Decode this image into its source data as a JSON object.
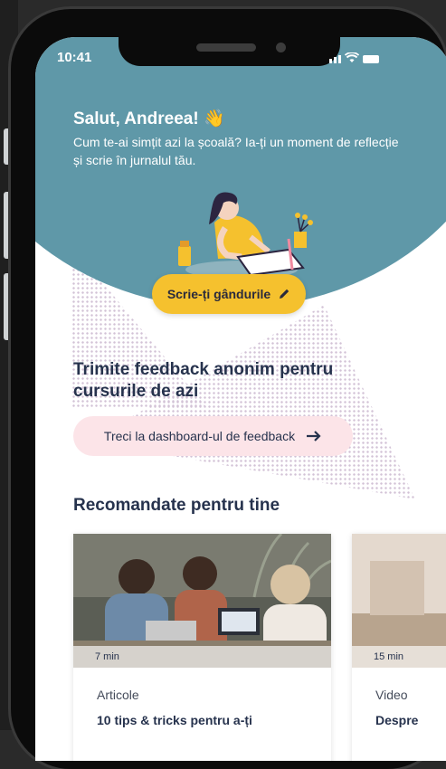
{
  "status_bar": {
    "time": "10:41"
  },
  "header": {
    "greeting": "Salut, Andreea! 👋",
    "subtitle": "Cum te-ai simțit azi la școală? Ia-ți un moment de reflecție și scrie în jurnalul tău.",
    "write_button_label": "Scrie-ți gândurile"
  },
  "feedback": {
    "title": "Trimite feedback anonim pentru cursurile de azi",
    "button_label": "Treci la dashboard-ul de feedback"
  },
  "recommendations": {
    "title": "Recomandate pentru tine",
    "cards": [
      {
        "duration": "7 min",
        "type": "Articole",
        "title": "10 tips & tricks pentru a-ți"
      },
      {
        "duration": "15 min",
        "type": "Video",
        "title": "Despre"
      }
    ]
  },
  "colors": {
    "hero": "#5f98a8",
    "accent_yellow": "#f5c12e",
    "pink_button": "#fce4e8",
    "heading": "#26324d"
  }
}
